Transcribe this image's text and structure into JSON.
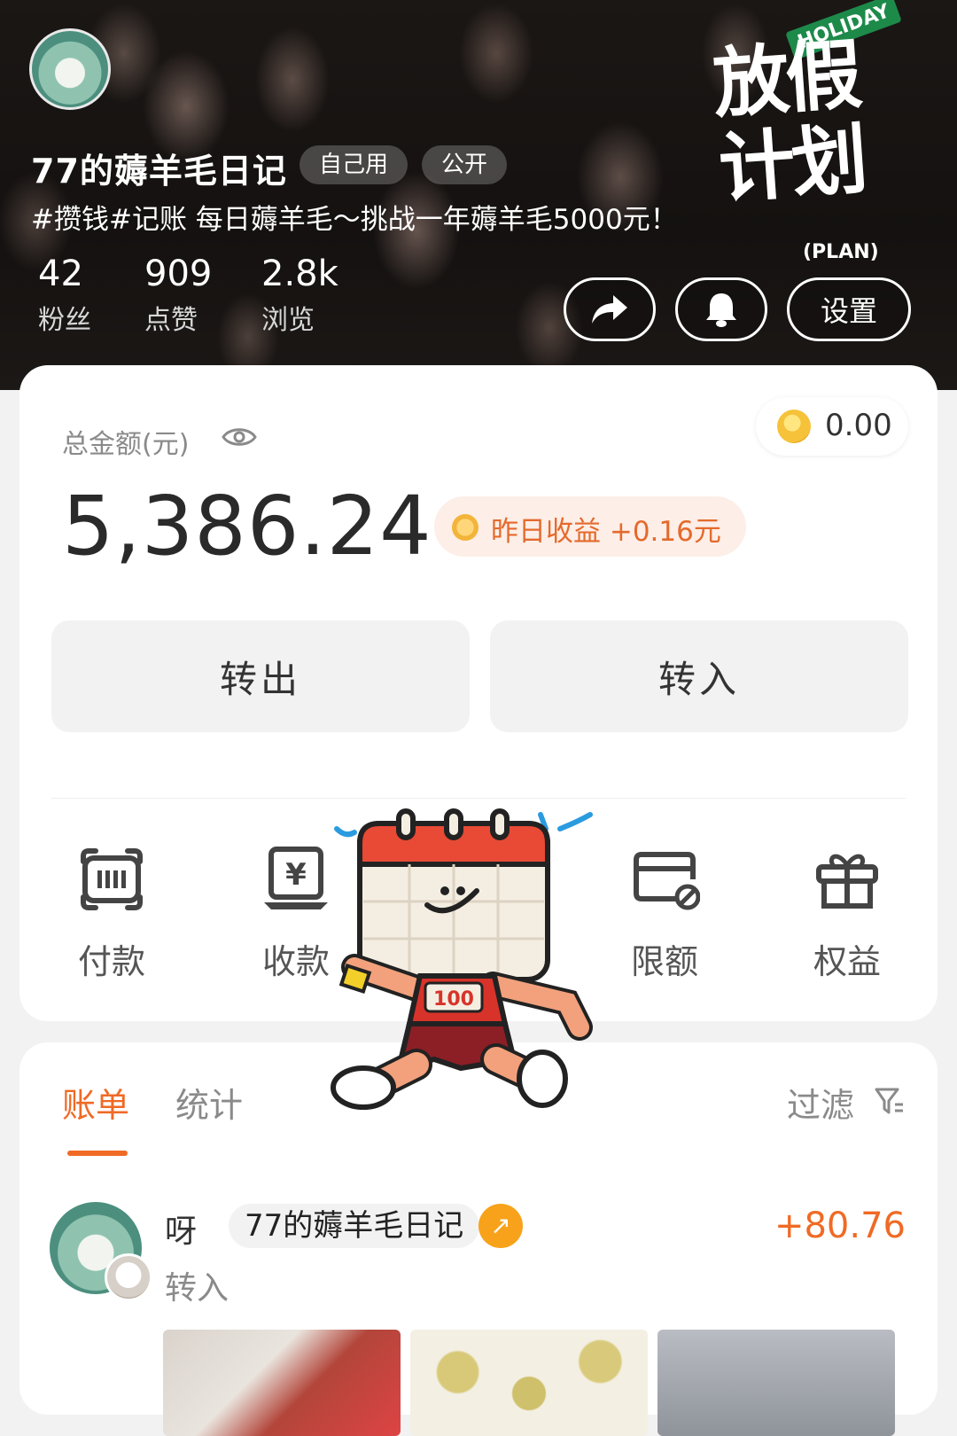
{
  "profile": {
    "name": "77的薅羊毛日记",
    "tag_private": "自己用",
    "tag_public": "公开",
    "bio": "#攒钱#记账   每日薅羊毛～挑战一年薅羊毛5000元！",
    "stats": [
      {
        "value": "42",
        "label": "粉丝"
      },
      {
        "value": "909",
        "label": "点赞"
      },
      {
        "value": "2.8k",
        "label": "浏览"
      }
    ],
    "settings_label": "设置",
    "banner": {
      "main": "放假计划",
      "flag": "HOLIDAY",
      "plan": "(PLAN)"
    }
  },
  "balance": {
    "label": "总金额(元)",
    "amount": "5,386.24",
    "coins": "0.00",
    "yesterday": "昨日收益 +0.16元"
  },
  "actions": {
    "out": "转出",
    "in": "转入"
  },
  "quick_actions": [
    {
      "label": "付款",
      "icon": "barcode-icon"
    },
    {
      "label": "收款",
      "icon": "receive-money-icon"
    },
    {
      "label": "限额",
      "icon": "card-limit-icon"
    },
    {
      "label": "权益",
      "icon": "gift-icon"
    }
  ],
  "ledger": {
    "tab_bill": "账单",
    "tab_stats": "统计",
    "filter": "过滤",
    "transaction": {
      "user": "呀",
      "account": "77的薅羊毛日记",
      "type": "转入",
      "amount": "+80.76"
    }
  },
  "sticker": {
    "number": "100"
  },
  "colors": {
    "accent": "#f06a25",
    "coin": "#f5c23a",
    "arrow": "#f7a21a"
  }
}
